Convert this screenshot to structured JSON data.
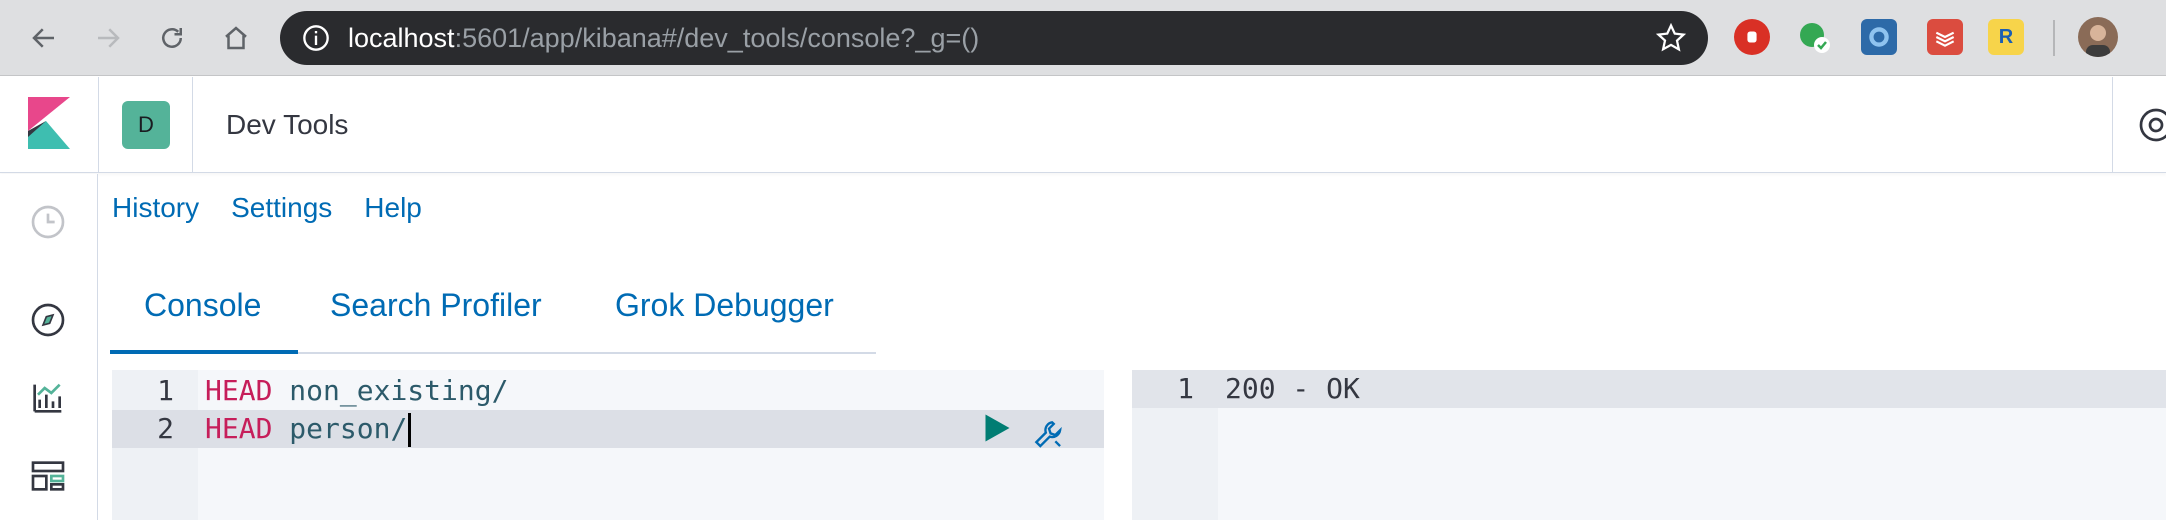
{
  "browser": {
    "url_host": "localhost",
    "url_rest": ":5601/app/kibana#/dev_tools/console?_g=()",
    "extension_r_label": "R"
  },
  "header": {
    "space_initial": "D",
    "app_title": "Dev Tools"
  },
  "top_menu": [
    "History",
    "Settings",
    "Help"
  ],
  "tabs": [
    {
      "label": "Console",
      "active": true
    },
    {
      "label": "Search Profiler",
      "active": false
    },
    {
      "label": "Grok Debugger",
      "active": false
    }
  ],
  "editor": {
    "lines": [
      {
        "no": "1",
        "verb": "HEAD",
        "path": "non_existing/"
      },
      {
        "no": "2",
        "verb": "HEAD",
        "path": "person/"
      }
    ]
  },
  "output": {
    "lines": [
      {
        "no": "1",
        "text": "200 - OK"
      }
    ]
  },
  "colors": {
    "link": "#006bb4",
    "verb": "#c61e5a",
    "space_avatar": "#54b399"
  }
}
